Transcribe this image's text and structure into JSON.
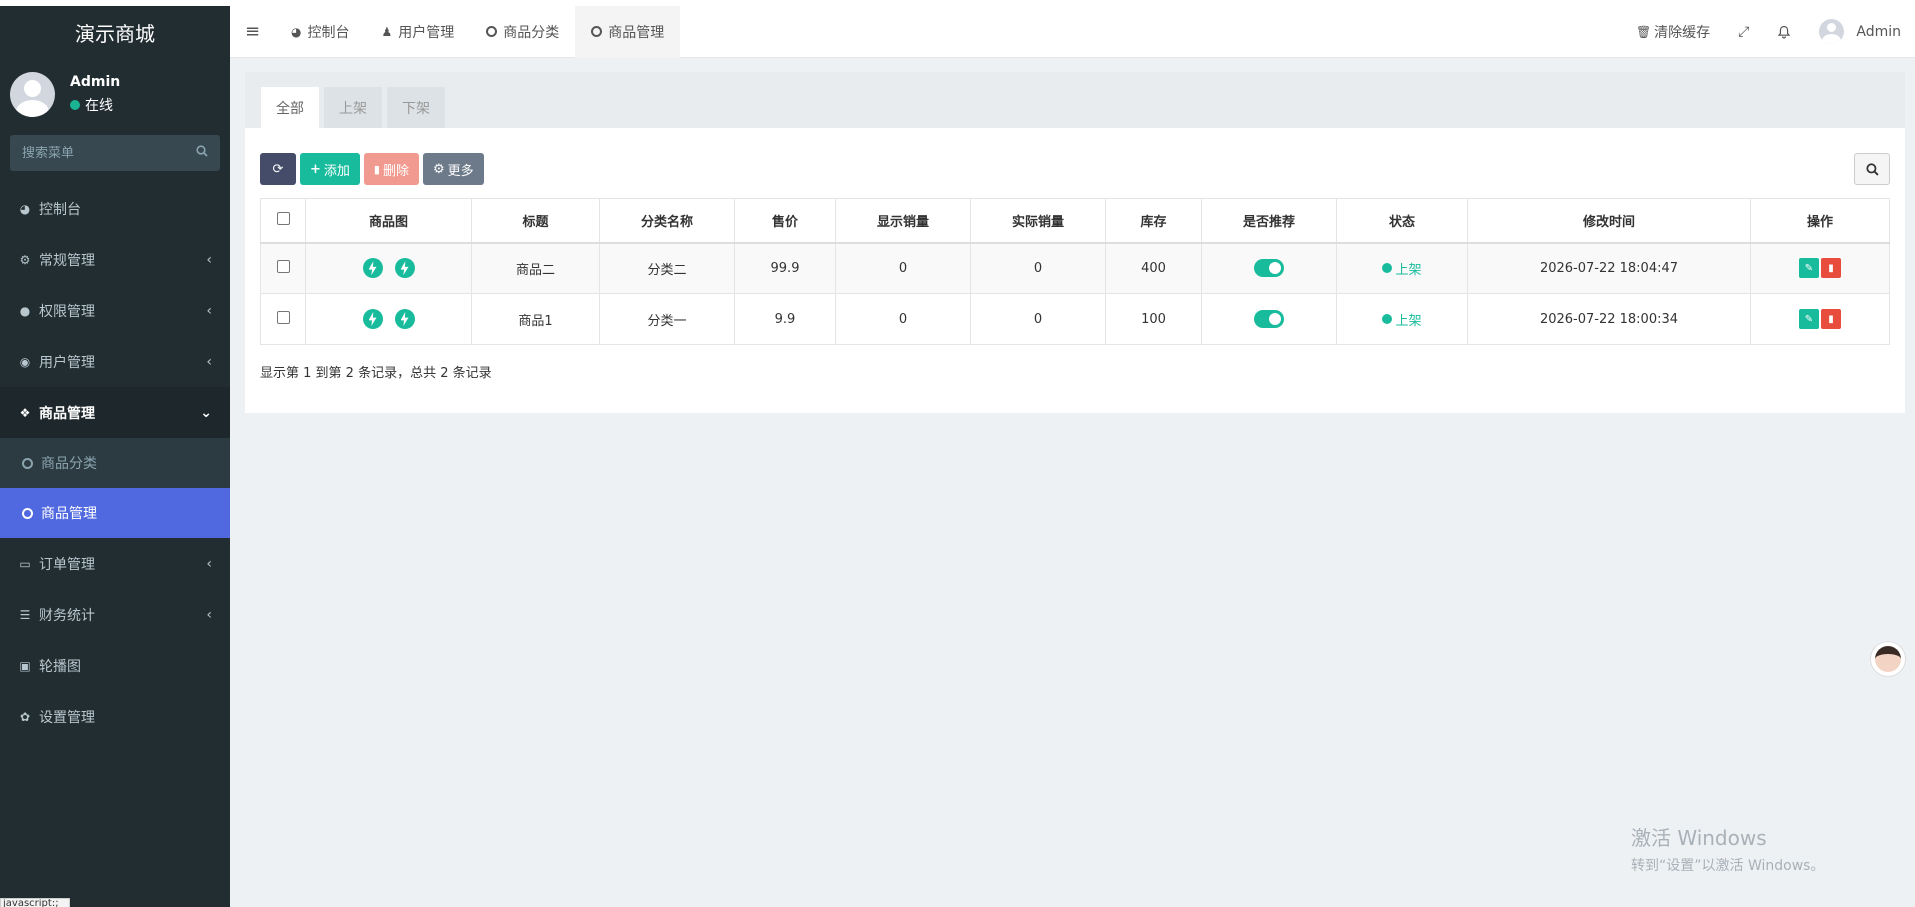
{
  "app": {
    "title": "演示商城"
  },
  "user": {
    "name": "Admin",
    "status": "在线"
  },
  "sidebar": {
    "search_placeholder": "搜索菜单",
    "items": [
      {
        "label": "控制台",
        "icon": "dashboard-icon"
      },
      {
        "label": "常规管理",
        "icon": "cogs-icon"
      },
      {
        "label": "权限管理",
        "icon": "group-icon"
      },
      {
        "label": "用户管理",
        "icon": "user-circle-icon"
      },
      {
        "label": "商品管理",
        "icon": "cubes-icon"
      },
      {
        "label": "订单管理",
        "icon": "desktop-icon"
      },
      {
        "label": "财务统计",
        "icon": "list-icon"
      },
      {
        "label": "轮播图",
        "icon": "image-icon"
      },
      {
        "label": "设置管理",
        "icon": "gear-icon"
      }
    ],
    "sub_items": [
      {
        "label": "商品分类"
      },
      {
        "label": "商品管理"
      }
    ]
  },
  "header": {
    "tabs": [
      {
        "label": "控制台"
      },
      {
        "label": "用户管理"
      },
      {
        "label": "商品分类"
      },
      {
        "label": "商品管理"
      }
    ],
    "clear_cache": "清除缓存",
    "user_name": "Admin"
  },
  "panel": {
    "tabs": [
      {
        "label": "全部"
      },
      {
        "label": "上架"
      },
      {
        "label": "下架"
      }
    ],
    "toolbar": {
      "add": "添加",
      "delete": "删除",
      "more": "更多"
    },
    "columns": [
      "商品图",
      "标题",
      "分类名称",
      "售价",
      "显示销量",
      "实际销量",
      "库存",
      "是否推荐",
      "状态",
      "修改时间",
      "操作"
    ],
    "rows": [
      {
        "title": "商品二",
        "category": "分类二",
        "price": "99.9",
        "shown_sales": "0",
        "actual_sales": "0",
        "stock": "400",
        "status": "上架",
        "modified": "2026-07-22 18:04:47"
      },
      {
        "title": "商品1",
        "category": "分类一",
        "price": "9.9",
        "shown_sales": "0",
        "actual_sales": "0",
        "stock": "100",
        "status": "上架",
        "modified": "2026-07-22 18:00:34"
      }
    ],
    "pager_text": "显示第 1 到第 2 条记录，总共 2 条记录"
  },
  "watermark": {
    "line1": "激活 Windows",
    "line2": "转到“设置”以激活 Windows。"
  },
  "js_badge": "javascript:;",
  "colors": {
    "sidebar_bg": "#222d32",
    "active_item": "#5068e0",
    "accent_green": "#18bc9c",
    "danger": "#e74c3c"
  }
}
